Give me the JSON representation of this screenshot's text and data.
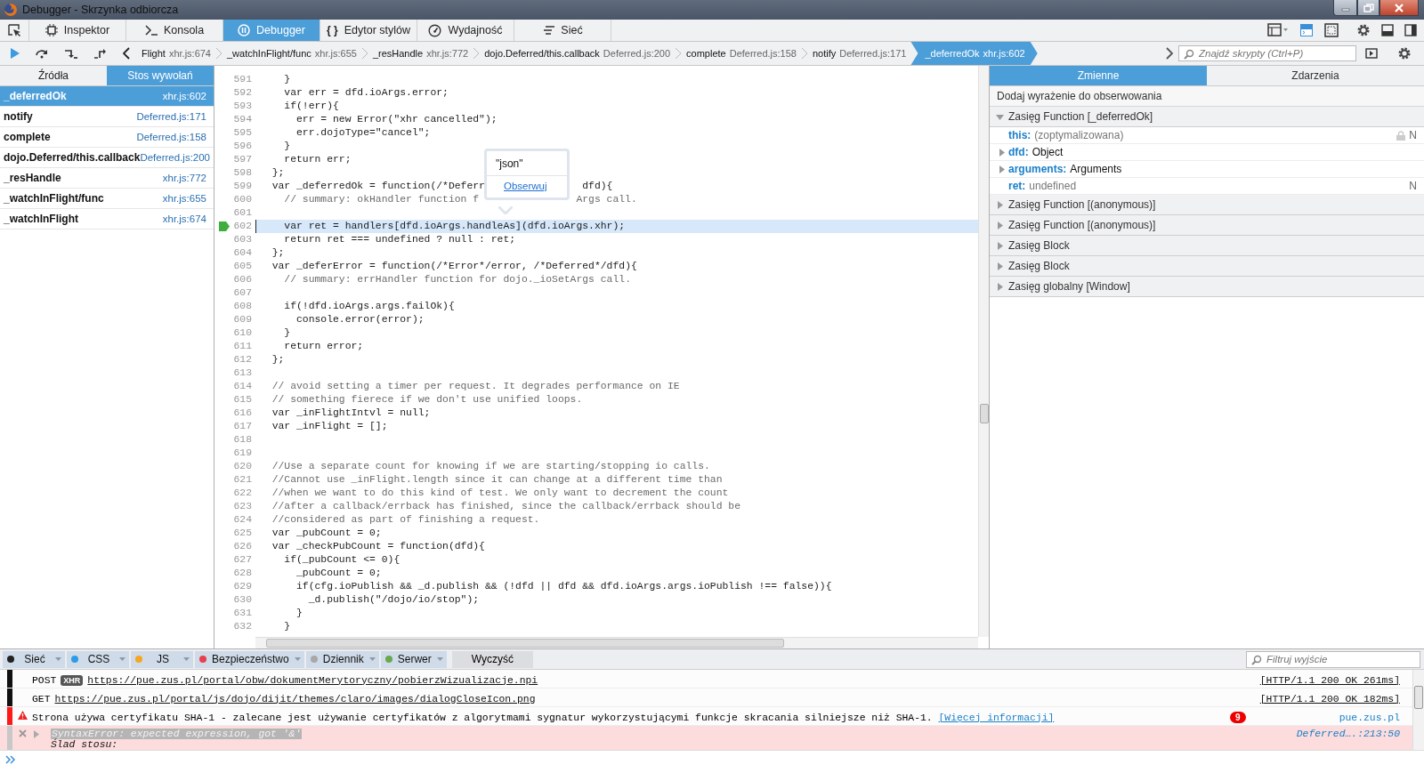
{
  "window": {
    "title": "Debugger - Skrzynka odbiorcza"
  },
  "toolbox": {
    "tabs": [
      {
        "label": "Inspektor",
        "selected": false
      },
      {
        "label": "Konsola",
        "selected": false
      },
      {
        "label": "Debugger",
        "selected": true
      },
      {
        "label": "Edytor stylów",
        "glyph": "{ }",
        "selected": false
      },
      {
        "label": "Wydajność",
        "selected": false
      },
      {
        "label": "Sieć",
        "selected": false
      }
    ]
  },
  "debugger": {
    "breadcrumbs": [
      {
        "name": "Flight",
        "location": "xhr.js:674",
        "selected": false
      },
      {
        "name": "_watchInFlight/func",
        "location": "xhr.js:655",
        "selected": false
      },
      {
        "name": "_resHandle",
        "location": "xhr.js:772",
        "selected": false
      },
      {
        "name": "dojo.Deferred/this.callback",
        "location": "Deferred.js:200",
        "selected": false
      },
      {
        "name": "complete",
        "location": "Deferred.js:158",
        "selected": false
      },
      {
        "name": "notify",
        "location": "Deferred.js:171",
        "selected": false
      },
      {
        "name": "_deferredOk",
        "location": "xhr.js:602",
        "selected": true
      }
    ],
    "search": {
      "placeholder": "Znajdź skrypty (Ctrl+P)"
    }
  },
  "sources_panel": {
    "tabs": [
      {
        "label": "Źródła",
        "selected": false
      },
      {
        "label": "Stos wywołań",
        "selected": true
      }
    ],
    "frames": [
      {
        "name": "_deferredOk",
        "location": "xhr.js:602",
        "selected": true
      },
      {
        "name": "notify",
        "location": "Deferred.js:171",
        "selected": false
      },
      {
        "name": "complete",
        "location": "Deferred.js:158",
        "selected": false
      },
      {
        "name": "dojo.Deferred/this.callback",
        "location": "Deferred.js:200",
        "selected": false
      },
      {
        "name": "_resHandle",
        "location": "xhr.js:772",
        "selected": false
      },
      {
        "name": "_watchInFlight/func",
        "location": "xhr.js:655",
        "selected": false
      },
      {
        "name": "_watchInFlight",
        "location": "xhr.js:674",
        "selected": false
      }
    ]
  },
  "editor": {
    "tooltip": {
      "value": "\"json\"",
      "action": "Obserwuj"
    },
    "lines": [
      {
        "number": "591",
        "text": "    }",
        "breakpoint": false,
        "paused": false
      },
      {
        "number": "592",
        "text": "    var err = dfd.ioArgs.error;",
        "breakpoint": false,
        "paused": false
      },
      {
        "number": "593",
        "text": "    if(!err){",
        "breakpoint": false,
        "paused": false
      },
      {
        "number": "594",
        "text": "      err = new Error(\"xhr cancelled\");",
        "breakpoint": false,
        "paused": false
      },
      {
        "number": "595",
        "text": "      err.dojoType=\"cancel\";",
        "breakpoint": false,
        "paused": false
      },
      {
        "number": "596",
        "text": "    }",
        "breakpoint": false,
        "paused": false
      },
      {
        "number": "597",
        "text": "    return err;",
        "breakpoint": false,
        "paused": false
      },
      {
        "number": "598",
        "text": "  };",
        "breakpoint": false,
        "paused": false
      },
      {
        "number": "599",
        "text": "  var _deferredOk = function(/*Deferr",
        "tail": "dfd){",
        "breakpoint": false,
        "paused": false
      },
      {
        "number": "600",
        "text": "    // summary: okHandler function f",
        "tail": "Args call.",
        "kind": "comment",
        "breakpoint": false,
        "paused": false
      },
      {
        "number": "601",
        "breakpoint": false,
        "paused": false
      },
      {
        "number": "602",
        "text": "    var ret = handlers[dfd.ioArgs.handleAs](dfd.ioArgs.xhr);",
        "breakpoint": true,
        "paused": true
      },
      {
        "number": "603",
        "text": "    return ret === undefined ? null : ret;",
        "breakpoint": false,
        "paused": false
      },
      {
        "number": "604",
        "text": "  };",
        "breakpoint": false,
        "paused": false
      },
      {
        "number": "605",
        "text": "  var _deferError = function(/*Error*/error, /*Deferred*/dfd){",
        "breakpoint": false,
        "paused": false
      },
      {
        "number": "606",
        "text": "    // summary: errHandler function for dojo._ioSetArgs call.",
        "kind": "comment",
        "breakpoint": false,
        "paused": false
      },
      {
        "number": "607",
        "breakpoint": false,
        "paused": false
      },
      {
        "number": "608",
        "text": "    if(!dfd.ioArgs.args.failOk){",
        "breakpoint": false,
        "paused": false
      },
      {
        "number": "609",
        "text": "      console.error(error);",
        "breakpoint": false,
        "paused": false
      },
      {
        "number": "610",
        "text": "    }",
        "breakpoint": false,
        "paused": false
      },
      {
        "number": "611",
        "text": "    return error;",
        "breakpoint": false,
        "paused": false
      },
      {
        "number": "612",
        "text": "  };",
        "breakpoint": false,
        "paused": false
      },
      {
        "number": "613",
        "breakpoint": false,
        "paused": false
      },
      {
        "number": "614",
        "text": "  // avoid setting a timer per request. It degrades performance on IE",
        "kind": "comment",
        "breakpoint": false,
        "paused": false
      },
      {
        "number": "615",
        "text": "  // something fierece if we don't use unified loops.",
        "kind": "comment",
        "breakpoint": false,
        "paused": false
      },
      {
        "number": "616",
        "text": "  var _inFlightIntvl = null;",
        "breakpoint": false,
        "paused": false
      },
      {
        "number": "617",
        "text": "  var _inFlight = [];",
        "breakpoint": false,
        "paused": false
      },
      {
        "number": "618",
        "breakpoint": false,
        "paused": false
      },
      {
        "number": "619",
        "breakpoint": false,
        "paused": false
      },
      {
        "number": "620",
        "text": "  //Use a separate count for knowing if we are starting/stopping io calls.",
        "kind": "comment",
        "breakpoint": false,
        "paused": false
      },
      {
        "number": "621",
        "text": "  //Cannot use _inFlight.length since it can change at a different time than",
        "kind": "comment",
        "breakpoint": false,
        "paused": false
      },
      {
        "number": "622",
        "text": "  //when we want to do this kind of test. We only want to decrement the count",
        "kind": "comment",
        "breakpoint": false,
        "paused": false
      },
      {
        "number": "623",
        "text": "  //after a callback/errback has finished, since the callback/errback should be",
        "kind": "comment",
        "breakpoint": false,
        "paused": false
      },
      {
        "number": "624",
        "text": "  //considered as part of finishing a request.",
        "kind": "comment",
        "breakpoint": false,
        "paused": false
      },
      {
        "number": "625",
        "text": "  var _pubCount = 0;",
        "breakpoint": false,
        "paused": false
      },
      {
        "number": "626",
        "text": "  var _checkPubCount = function(dfd){",
        "breakpoint": false,
        "paused": false
      },
      {
        "number": "627",
        "text": "    if(_pubCount <= 0){",
        "breakpoint": false,
        "paused": false
      },
      {
        "number": "628",
        "text": "      _pubCount = 0;",
        "breakpoint": false,
        "paused": false
      },
      {
        "number": "629",
        "text": "      if(cfg.ioPublish && _d.publish && (!dfd || dfd && dfd.ioArgs.args.ioPublish !== false)){",
        "breakpoint": false,
        "paused": false
      },
      {
        "number": "630",
        "text": "        _d.publish(\"/dojo/io/stop\");",
        "breakpoint": false,
        "paused": false
      },
      {
        "number": "631",
        "text": "      }",
        "breakpoint": false,
        "paused": false
      },
      {
        "number": "632",
        "text": "    }",
        "breakpoint": false,
        "paused": false
      }
    ]
  },
  "variables_panel": {
    "tabs": [
      {
        "label": "Zmienne",
        "selected": true
      },
      {
        "label": "Zdarzenia",
        "selected": false
      }
    ],
    "watch": {
      "placeholder": "Dodaj wyrażenie do obserwowania"
    },
    "scopes": [
      {
        "label": "Zasięg Function [_deferredOk]",
        "expanded": true,
        "variables": [
          {
            "name": "this:",
            "value": "(zoptymalizowana)",
            "kind": "primitive",
            "expandable": false,
            "locked": true,
            "flag": "N"
          },
          {
            "name": "dfd:",
            "value": "Object",
            "kind": "object",
            "expandable": true,
            "locked": false
          },
          {
            "name": "arguments:",
            "value": "Arguments",
            "kind": "object",
            "expandable": true,
            "locked": false
          },
          {
            "name": "ret:",
            "value": "undefined",
            "kind": "primitive",
            "expandable": false,
            "locked": false,
            "flag": "N"
          }
        ]
      },
      {
        "label": "Zasięg Function [(anonymous)]",
        "expanded": false
      },
      {
        "label": "Zasięg Function [(anonymous)]",
        "expanded": false
      },
      {
        "label": "Zasięg Block",
        "expanded": false
      },
      {
        "label": "Zasięg Block",
        "expanded": false
      },
      {
        "label": "Zasięg globalny [Window]",
        "expanded": false
      }
    ]
  },
  "console": {
    "filters": [
      {
        "label": "Sieć",
        "color": "#222222"
      },
      {
        "label": "CSS",
        "color": "#2e9be6"
      },
      {
        "label": "JS",
        "color": "#f5a623"
      },
      {
        "label": "Bezpieczeństwo",
        "color": "#e8404e"
      },
      {
        "label": "Dziennik",
        "color": "#a8a8a8"
      },
      {
        "label": "Serwer",
        "color": "#6aa84f"
      }
    ],
    "clear": "Wyczyść",
    "filter_field": {
      "placeholder": "Filtruj wyjście"
    },
    "messages": [
      {
        "kind": "network",
        "method": "POST",
        "badge": "XHR",
        "url": "https://pue.zus.pl/portal/obw/dokumentMerytoryczny/pobierzWizualizacje.npi",
        "status": "[HTTP/1.1 200 OK 261ms]"
      },
      {
        "kind": "network",
        "method": "GET",
        "url": "https://pue.zus.pl/portal/js/dojo/dijit/themes/claro/images/dialogCloseIcon.png",
        "status": "[HTTP/1.1 200 OK 182ms]"
      },
      {
        "kind": "warning",
        "text": "Strona używa certyfikatu SHA-1 - zalecane jest używanie certyfikatów z algorytmami sygnatur wykorzystującymi funkcje skracania silniejsze niż SHA-1.",
        "link": "[Więcej informacji]",
        "count": "9",
        "source": "pue.zus.pl"
      },
      {
        "kind": "error",
        "text": "SyntaxError: expected expression, got '&'",
        "detail": "Ślad stosu:",
        "source": "Deferred….:213:50",
        "expanded": false
      }
    ]
  }
}
